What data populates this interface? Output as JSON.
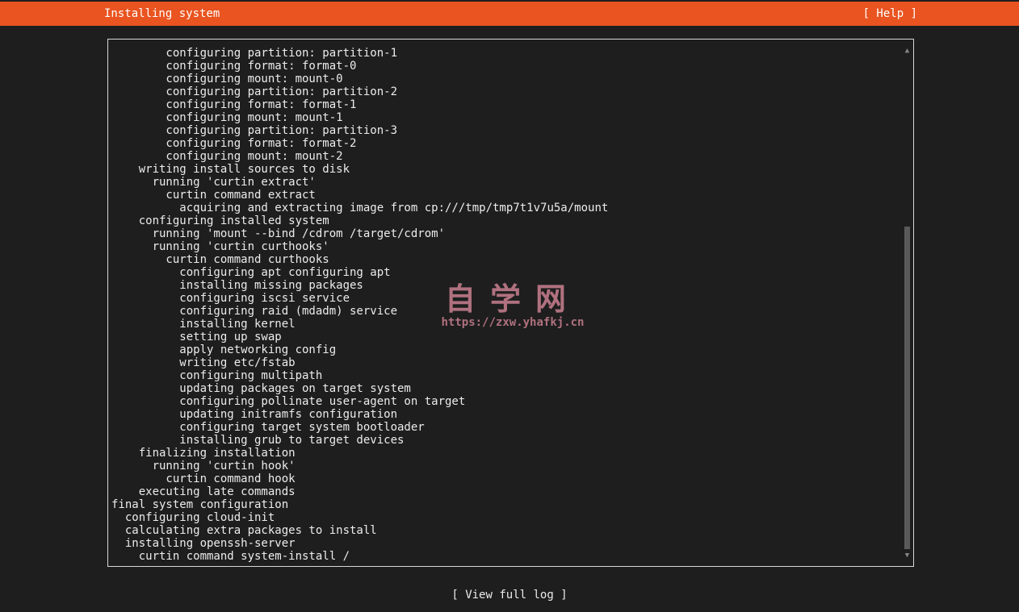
{
  "header": {
    "title": "Installing system",
    "help_label": "[ Help ]"
  },
  "log": {
    "lines": [
      "        configuring partition: partition-1",
      "        configuring format: format-0",
      "        configuring mount: mount-0",
      "        configuring partition: partition-2",
      "        configuring format: format-1",
      "        configuring mount: mount-1",
      "        configuring partition: partition-3",
      "        configuring format: format-2",
      "        configuring mount: mount-2",
      "    writing install sources to disk",
      "      running 'curtin extract'",
      "        curtin command extract",
      "          acquiring and extracting image from cp:///tmp/tmp7t1v7u5a/mount",
      "    configuring installed system",
      "      running 'mount --bind /cdrom /target/cdrom'",
      "      running 'curtin curthooks'",
      "        curtin command curthooks",
      "          configuring apt configuring apt",
      "          installing missing packages",
      "          configuring iscsi service",
      "          configuring raid (mdadm) service",
      "          installing kernel",
      "          setting up swap",
      "          apply networking config",
      "          writing etc/fstab",
      "          configuring multipath",
      "          updating packages on target system",
      "          configuring pollinate user-agent on target",
      "          updating initramfs configuration",
      "          configuring target system bootloader",
      "          installing grub to target devices",
      "    finalizing installation",
      "      running 'curtin hook'",
      "        curtin command hook",
      "    executing late commands",
      "final system configuration",
      "  configuring cloud-init",
      "  calculating extra packages to install",
      "  installing openssh-server",
      "    curtin command system-install /"
    ]
  },
  "watermark": {
    "title": "自学网",
    "url": "https://zxw.yhafkj.cn"
  },
  "footer": {
    "view_log_label": "[ View full log ]"
  },
  "icons": {
    "scroll_up": "scroll-up-arrow-icon",
    "scroll_down": "scroll-down-arrow-icon"
  },
  "colors": {
    "accent": "#e95420",
    "background": "#1e1e1e",
    "text": "#ececec"
  }
}
